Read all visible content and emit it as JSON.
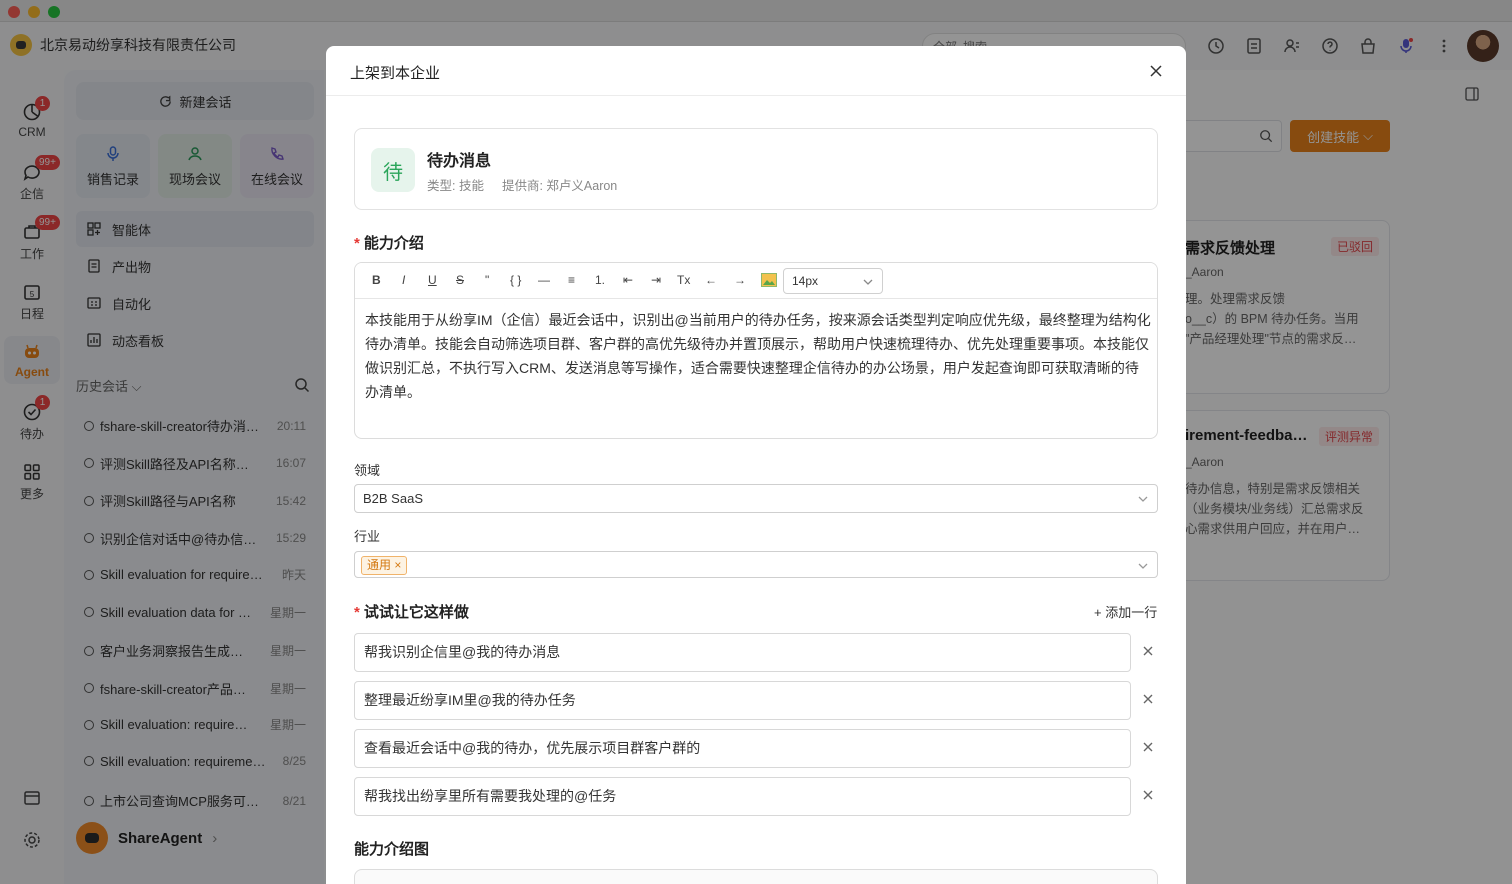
{
  "window": {
    "traffic_lights": {
      "close": "#fe5f57",
      "minimize": "#febc2e",
      "maximize": "#28c840"
    }
  },
  "topbar": {
    "company": "北京易动纷享科技有限责任公司",
    "scope": "全部",
    "search_placeholder": "搜索"
  },
  "rail": {
    "items": [
      {
        "label": "CRM",
        "badge": "1"
      },
      {
        "label": "企信",
        "badge": "99+"
      },
      {
        "label": "工作",
        "badge": "99+"
      },
      {
        "label": "日程",
        "badge": ""
      },
      {
        "label": "Agent",
        "badge": ""
      },
      {
        "label": "待办",
        "badge": "1"
      },
      {
        "label": "更多",
        "badge": ""
      }
    ],
    "calendar_day": "5",
    "accent": "#e8821a"
  },
  "sidebar": {
    "new_chat": "新建会话",
    "quick_actions": [
      "销售记录",
      "现场会议",
      "在线会议"
    ],
    "nav": [
      "智能体",
      "产出物",
      "自动化",
      "动态看板"
    ],
    "history_label": "历史会话",
    "history": [
      {
        "title": "fshare-skill-creator待办消…",
        "time": "20:11"
      },
      {
        "title": "评测Skill路径及API名称…",
        "time": "16:07"
      },
      {
        "title": "评测Skill路径与API名称",
        "time": "15:42"
      },
      {
        "title": "识别企信对话中@待办信…",
        "time": "15:29"
      },
      {
        "title": "Skill evaluation for require…",
        "time": "昨天"
      },
      {
        "title": "Skill evaluation data for …",
        "time": "星期一"
      },
      {
        "title": "客户业务洞察报告生成…",
        "time": "星期一"
      },
      {
        "title": "fshare-skill-creator产品…",
        "time": "星期一"
      },
      {
        "title": "Skill evaluation: require…",
        "time": "星期一"
      },
      {
        "title": "Skill evaluation: requireme…",
        "time": "8/25"
      },
      {
        "title": "上市公司查询MCP服务可…",
        "time": "8/21"
      }
    ],
    "agent_name": "ShareAgent"
  },
  "background": {
    "create_skill": "创建技能",
    "cards": [
      {
        "title": "需求反馈处理",
        "badge": "已驳回",
        "badge_color": "#e5484d",
        "author": "_Aaron",
        "desc": [
          "理。处理需求反馈",
          "o__c）的 BPM 待办任务。当用",
          "\"产品经理处理\"节点的需求反…"
        ]
      },
      {
        "title": "irement-feedba…",
        "badge": "评测异常",
        "badge_color": "#e5484d",
        "author": "_Aaron",
        "desc": [
          "待办信息，特别是需求反馈相关",
          "（业务模块/业务线）汇总需求反",
          "心需求供用户回应，并在用户…"
        ]
      }
    ]
  },
  "modal": {
    "title": "上架到本企业",
    "skill": {
      "icon_char": "待",
      "name": "待办消息",
      "type": "类型: 技能",
      "provider": "提供商: 郑卢义Aaron"
    },
    "intro_label": "能力介绍",
    "toolbar": {
      "buttons": [
        "B",
        "I",
        "U",
        "S",
        "\"",
        "{ }",
        "—",
        "≡",
        "1.",
        "⇤",
        "⇥",
        "Tx",
        "←",
        "→"
      ],
      "font_size": "14px"
    },
    "intro_text": "本技能用于从纷享IM（企信）最近会话中，识别出@当前用户的待办任务，按来源会话类型判定响应优先级，最终整理为结构化待办清单。技能会自动筛选项目群、客户群的高优先级待办并置顶展示，帮助用户快速梳理待办、优先处理重要事项。本技能仅做识别汇总，不执行写入CRM、发送消息等写操作，适合需要快速整理企信待办的办公场景，用户发起查询即可获取清晰的待办清单。",
    "domain_label": "领域",
    "domain_value": "B2B SaaS",
    "industry_label": "行业",
    "industry_tag": "通用",
    "try_label": "试试让它这样做",
    "add_row": "+ 添加一行",
    "prompts": [
      "帮我识别企信里@我的待办消息",
      "整理最近纷享IM里@我的待办任务",
      "查看最近会话中@我的待办，优先展示项目群客户群的",
      "帮我找出纷享里所有需要我处理的@任务"
    ],
    "image_label": "能力介绍图"
  }
}
